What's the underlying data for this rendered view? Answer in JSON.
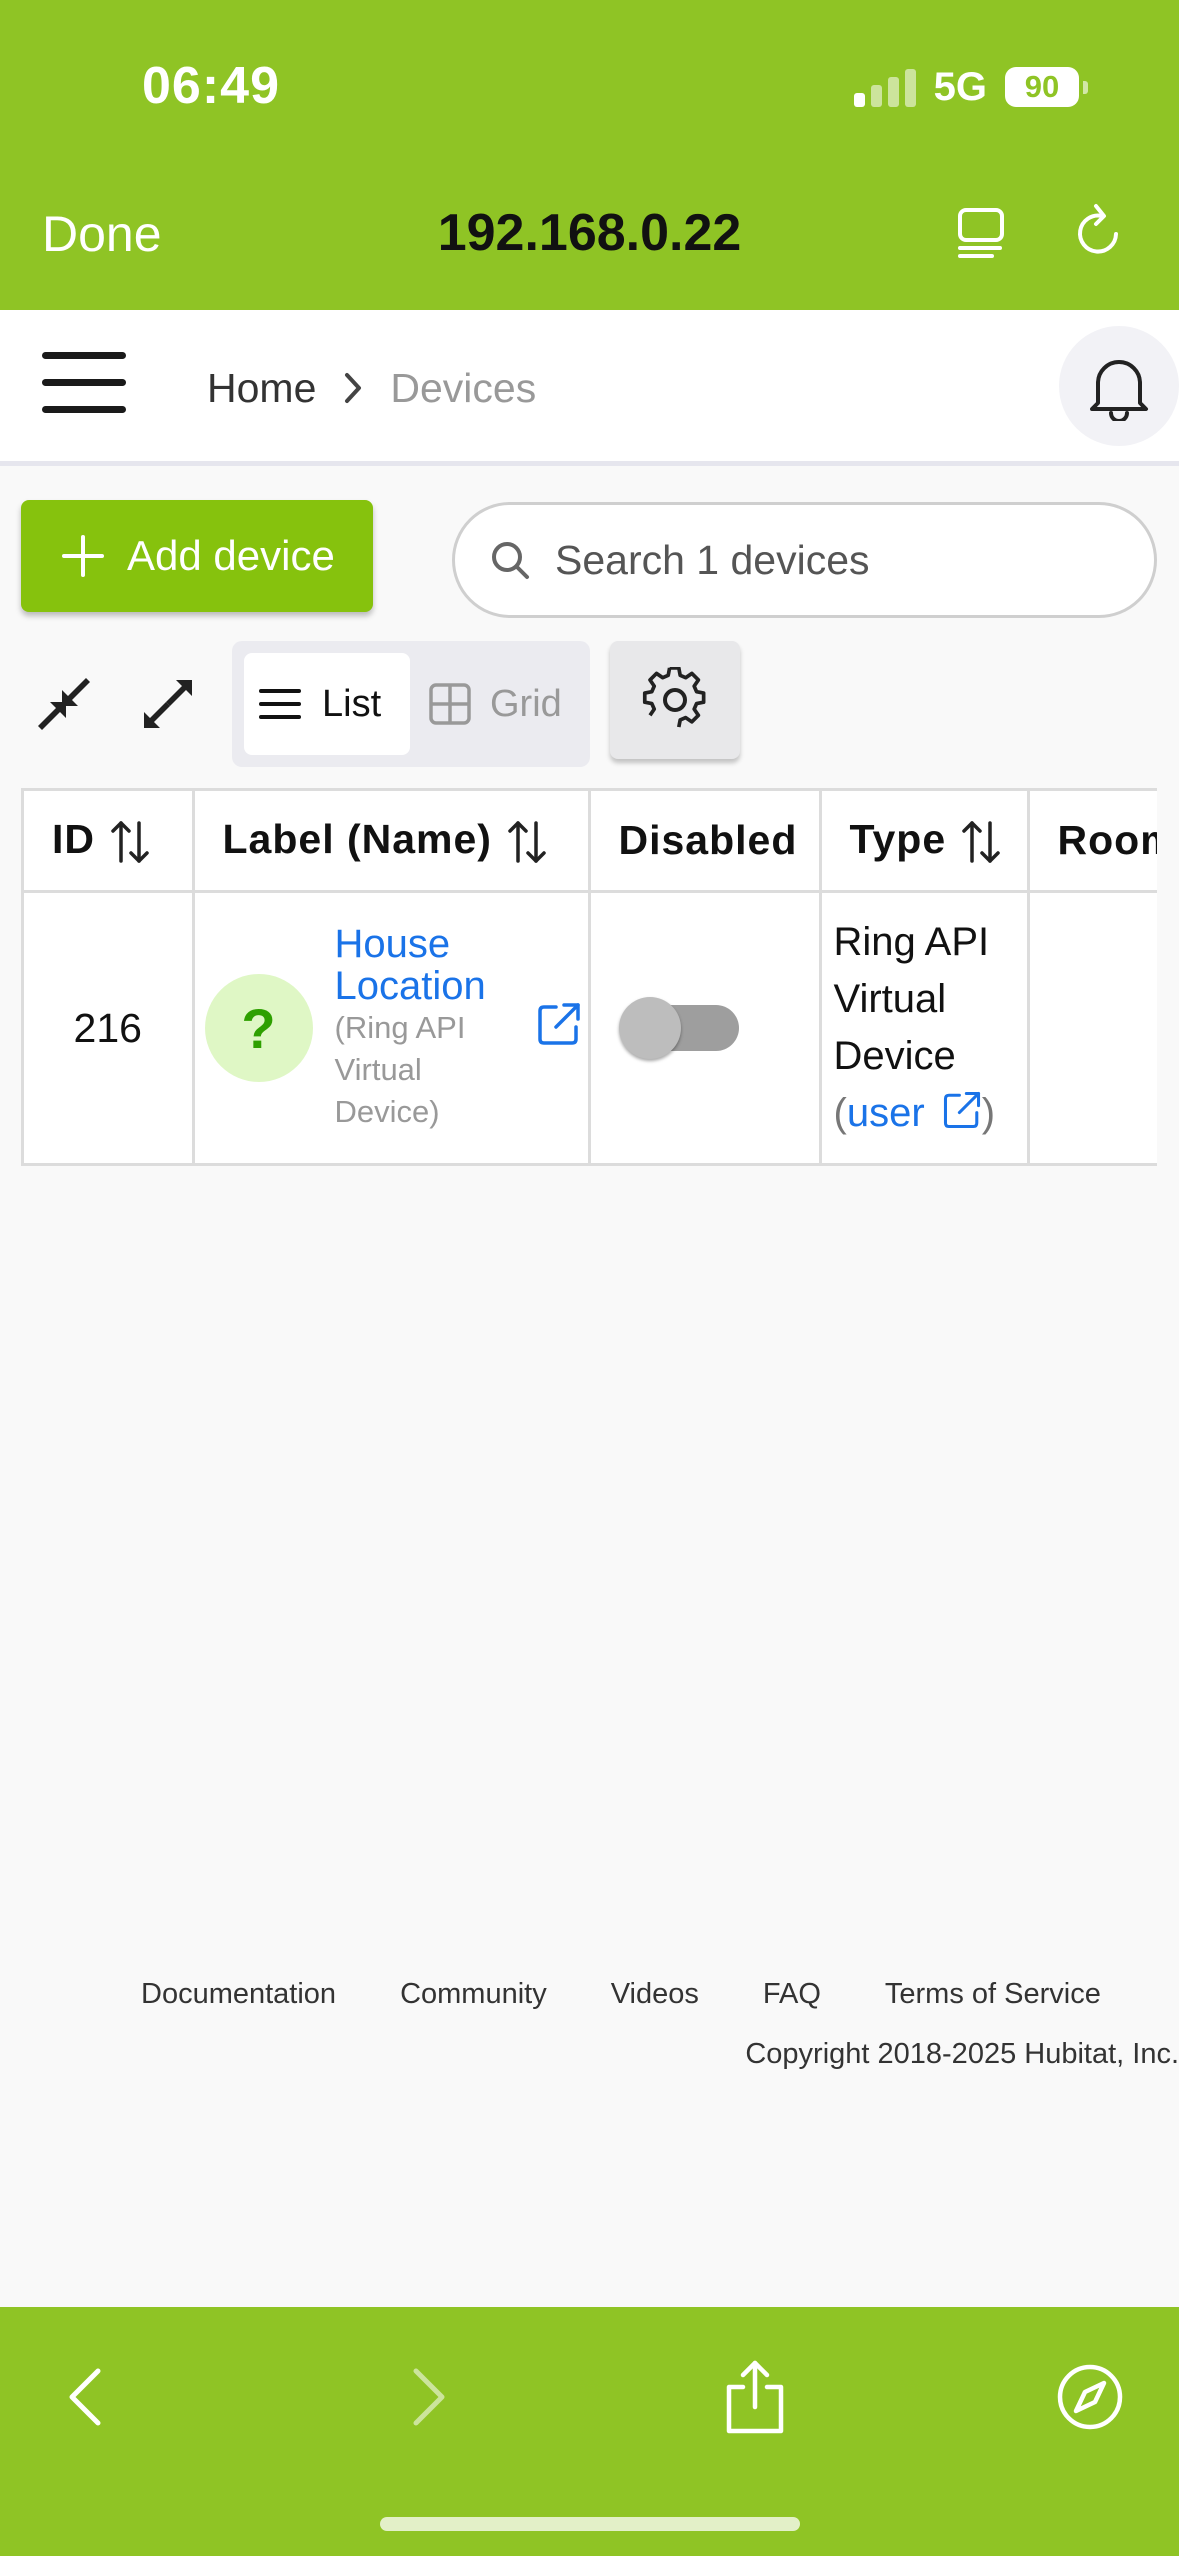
{
  "status_bar": {
    "time": "06:49",
    "network": "5G",
    "battery": "90"
  },
  "safari": {
    "done_label": "Done",
    "url": "192.168.0.22"
  },
  "header": {
    "breadcrumb": [
      "Home",
      "Devices"
    ]
  },
  "toolbar": {
    "add_device_label": "Add device",
    "search_placeholder": "Search 1 devices",
    "view_list_label": "List",
    "view_grid_label": "Grid"
  },
  "table": {
    "columns": [
      "ID",
      "Label (Name)",
      "Disabled",
      "Type",
      "Room"
    ],
    "rows": [
      {
        "id": "216",
        "avatar_glyph": "?",
        "label_line1": "House",
        "label_line2": "Location",
        "name_line1": "(Ring API",
        "name_line2": "Virtual",
        "name_line3": "Device)",
        "disabled": false,
        "type_line1": "Ring API",
        "type_line2": "Virtual",
        "type_line3": "Device",
        "type_open": "(",
        "type_link": "user",
        "type_close": ")",
        "room": ""
      }
    ]
  },
  "footer": {
    "links": [
      "Documentation",
      "Community",
      "Videos",
      "FAQ",
      "Terms of Service"
    ],
    "copyright": "Copyright 2018-2025 Hubitat, Inc."
  },
  "colors": {
    "safari_bar": "#8fc425",
    "add_button": "#86c20d",
    "link": "#1a73e8"
  },
  "icons": [
    "reader-icon",
    "reload-icon",
    "menu-icon",
    "chevron-right-icon",
    "bell-icon",
    "plus-icon",
    "search-icon",
    "collapse-icon",
    "expand-icon",
    "list-icon",
    "grid-icon",
    "gear-icon",
    "sort-icon",
    "external-link-icon",
    "back-icon",
    "forward-icon",
    "share-icon",
    "compass-icon"
  ]
}
